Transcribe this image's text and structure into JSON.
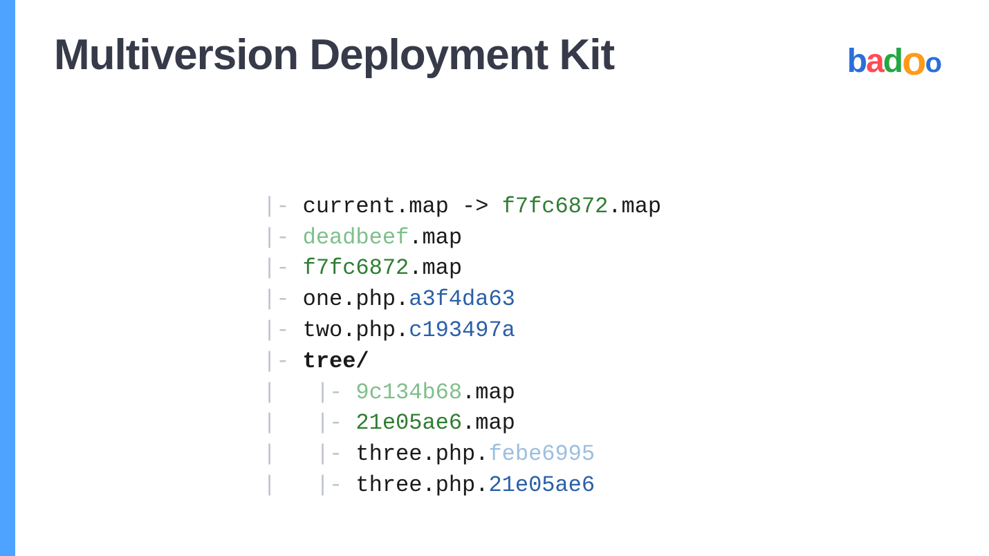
{
  "title": "Multiversion Deployment Kit",
  "logo": {
    "b": "b",
    "a": "a",
    "d": "d",
    "o1": "o",
    "o2": "o"
  },
  "tree": {
    "line1": {
      "pipe": "|- ",
      "pre": "current.map -> ",
      "hash": "f7fc6872",
      "post": ".map"
    },
    "line2": {
      "pipe": "|- ",
      "hash": "deadbeef",
      "post": ".map"
    },
    "line3": {
      "pipe": "|- ",
      "hash": "f7fc6872",
      "post": ".map"
    },
    "line4": {
      "pipe": "|- ",
      "pre": "one.php.",
      "hash": "a3f4da63"
    },
    "line5": {
      "pipe": "|- ",
      "pre": "two.php.",
      "hash": "c193497a"
    },
    "line6": {
      "pipe": "|- ",
      "dir": "tree/"
    },
    "line7": {
      "pipe": "|   |- ",
      "hash": "9c134b68",
      "post": ".map"
    },
    "line8": {
      "pipe": "|   |- ",
      "hash": "21e05ae6",
      "post": ".map"
    },
    "line9": {
      "pipe": "|   |- ",
      "pre": "three.php.",
      "hash": "febe6995"
    },
    "line10": {
      "pipe": "|   |- ",
      "pre": "three.php.",
      "hash": "21e05ae6"
    }
  }
}
